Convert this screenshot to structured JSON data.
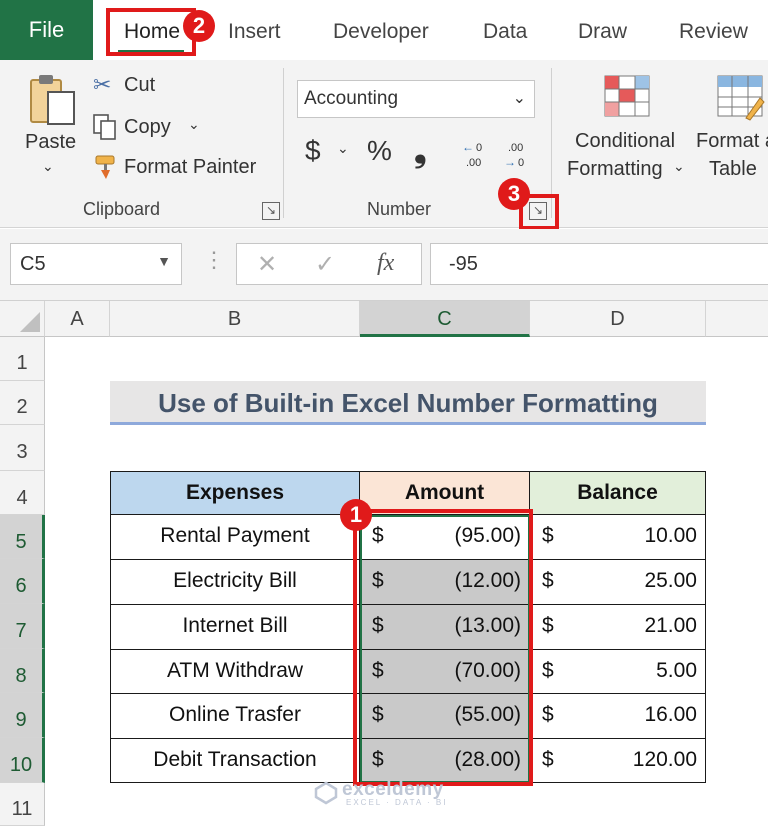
{
  "ribbon_tabs": [
    "File",
    "Home",
    "Insert",
    "Developer",
    "Data",
    "Draw",
    "Review"
  ],
  "clipboard": {
    "paste": "Paste",
    "cut": "Cut",
    "copy": "Copy",
    "format_painter": "Format Painter",
    "group_label": "Clipboard"
  },
  "number": {
    "format_value": "Accounting",
    "group_label": "Number"
  },
  "styles": {
    "conditional_line1": "Conditional",
    "conditional_line2": "Formatting",
    "format_table_line1": "Format a",
    "format_table_line2": "Table"
  },
  "formula_bar": {
    "name_box": "C5",
    "formula": "-95"
  },
  "columns": [
    "A",
    "B",
    "C",
    "D"
  ],
  "rows": [
    "1",
    "2",
    "3",
    "4",
    "5",
    "6",
    "7",
    "8",
    "9",
    "10",
    "11"
  ],
  "sheet": {
    "title": "Use of Built-in Excel Number Formatting",
    "headers": [
      "Expenses",
      "Amount",
      "Balance"
    ],
    "records": [
      {
        "expense": "Rental Payment",
        "amount": "(95.00)",
        "balance": "10.00"
      },
      {
        "expense": "Electricity Bill",
        "amount": "(12.00)",
        "balance": "25.00"
      },
      {
        "expense": "Internet Bill",
        "amount": "(13.00)",
        "balance": "21.00"
      },
      {
        "expense": "ATM Withdraw",
        "amount": "(70.00)",
        "balance": "5.00"
      },
      {
        "expense": "Online Trasfer",
        "amount": "(55.00)",
        "balance": "16.00"
      },
      {
        "expense": "Debit Transaction",
        "amount": "(28.00)",
        "balance": "120.00"
      }
    ],
    "currency_symbol": "$"
  },
  "badges": [
    "1",
    "2",
    "3"
  ],
  "watermark": {
    "name": "exceldemy",
    "tagline": "EXCEL · DATA · BI"
  },
  "colors": {
    "excel_green": "#217346",
    "highlight_red": "#e01a1a",
    "expenses_header": "#bdd7ee",
    "amount_header": "#fbe5d6",
    "balance_header": "#e2efda",
    "selected_fill": "#c9c9c9",
    "title_fill": "#e7e6e6",
    "title_text": "#44546a"
  }
}
